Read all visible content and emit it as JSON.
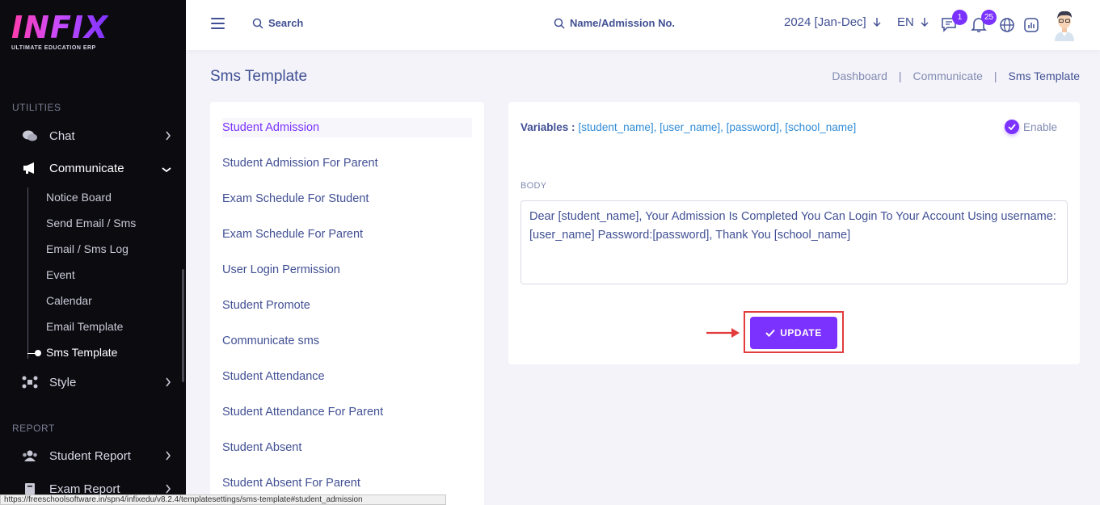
{
  "brand": {
    "logo_text": "INFIX",
    "tagline": "ULTIMATE EDUCATION ERP",
    "accent_color": "#7c32ff"
  },
  "sidebar": {
    "section_utilities": "UTILITIES",
    "chat_label": "Chat",
    "communicate_label": "Communicate",
    "submenu": [
      "Notice Board",
      "Send Email / Sms",
      "Email / Sms Log",
      "Event",
      "Calendar",
      "Email Template",
      "Sms Template"
    ],
    "active_submenu": "Sms Template",
    "style_label": "Style",
    "section_report": "REPORT",
    "student_report_label": "Student Report",
    "exam_report_label": "Exam Report"
  },
  "header": {
    "search_label": "Search",
    "name_search_label": "Name/Admission No.",
    "academic_year": "2024 [Jan-Dec]",
    "language": "EN",
    "messages_badge": "1",
    "notifications_badge": "25"
  },
  "page": {
    "title": "Sms Template",
    "breadcrumb": [
      "Dashboard",
      "Communicate",
      "Sms Template"
    ]
  },
  "templates": {
    "items": [
      "Student Admission",
      "Student Admission For Parent",
      "Exam Schedule For Student",
      "Exam Schedule For Parent",
      "User Login Permission",
      "Student Promote",
      "Communicate sms",
      "Student Attendance",
      "Student Attendance For Parent",
      "Student Absent",
      "Student Absent For Parent"
    ],
    "active": "Student Admission"
  },
  "editor": {
    "variables_label": "Variables :",
    "variables_value": "[student_name], [user_name], [password], [school_name]",
    "enable_label": "Enable",
    "enable_checked": true,
    "body_label": "BODY",
    "body_text": "Dear [student_name], Your Admission Is Completed You Can Login To Your Account Using username:[user_name] Password:[password], Thank You [school_name]",
    "update_label": "UPDATE"
  },
  "statusbar": {
    "url": "https://freeschoolsoftware.in/spn4/infixedu/v8.2.4/templatesettings/sms-template#student_admission"
  }
}
